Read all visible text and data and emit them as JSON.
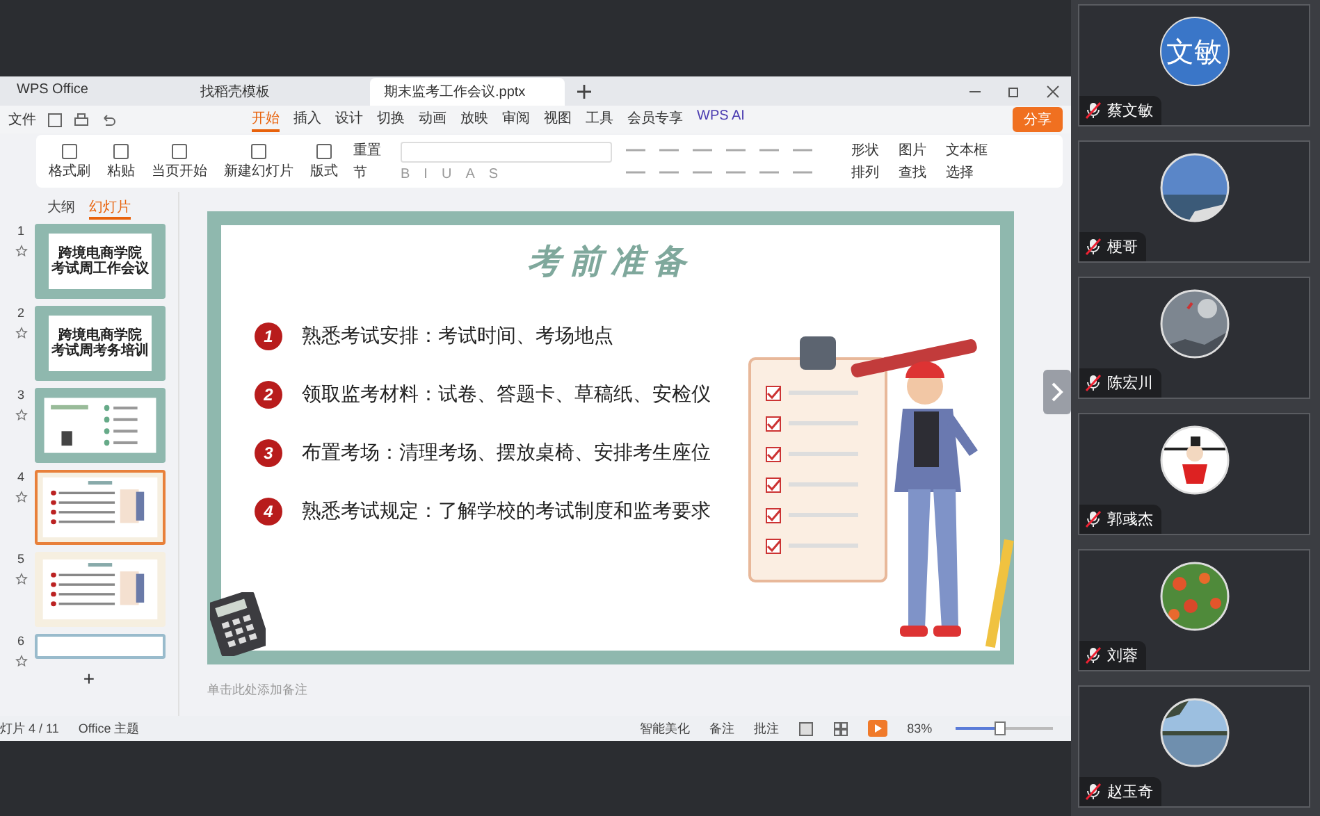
{
  "tabs": [
    {
      "label": "WPS Office",
      "selected": false
    },
    {
      "label": "找稻壳模板",
      "selected": false
    },
    {
      "label": "期末监考工作会议.pptx",
      "selected": true
    }
  ],
  "menu": {
    "file": "文件",
    "tabs": [
      {
        "label": "开始",
        "selected": true
      },
      {
        "label": "插入",
        "selected": false
      },
      {
        "label": "设计",
        "selected": false
      },
      {
        "label": "切换",
        "selected": false
      },
      {
        "label": "动画",
        "selected": false
      },
      {
        "label": "放映",
        "selected": false
      },
      {
        "label": "审阅",
        "selected": false
      },
      {
        "label": "视图",
        "selected": false
      },
      {
        "label": "工具",
        "selected": false
      },
      {
        "label": "会员专享",
        "selected": false
      }
    ],
    "ai": "WPS AI",
    "share": "分享"
  },
  "ribbon": {
    "left": [
      {
        "label": "格式刷"
      },
      {
        "label": "粘贴"
      },
      {
        "label": "当页开始"
      },
      {
        "label": "新建幻灯片"
      },
      {
        "label": "版式"
      }
    ],
    "small": [
      {
        "label": "重置"
      },
      {
        "label": "节"
      }
    ],
    "format_buttons": [
      "B",
      "I",
      "U",
      "A",
      "S"
    ],
    "right": [
      {
        "label": "形状"
      },
      {
        "label": "图片"
      },
      {
        "label": "文本框"
      },
      {
        "label": "排列"
      },
      {
        "label": "查找"
      },
      {
        "label": "选择"
      }
    ]
  },
  "panel": {
    "tabs": [
      {
        "label": "大纲",
        "selected": false
      },
      {
        "label": "幻灯片",
        "selected": true
      }
    ],
    "slides": [
      {
        "number": "1",
        "kind": "title",
        "lines": [
          "跨境电商学院",
          "考试周工作会议"
        ],
        "selected": false
      },
      {
        "number": "2",
        "kind": "title",
        "lines": [
          "跨境电商学院",
          "考试周考务培训"
        ],
        "selected": false
      },
      {
        "number": "3",
        "kind": "list",
        "selected": false
      },
      {
        "number": "4",
        "kind": "content",
        "selected": true
      },
      {
        "number": "5",
        "kind": "content",
        "selected": false
      },
      {
        "number": "6",
        "kind": "partial",
        "selected": false
      }
    ],
    "add": "+"
  },
  "slide": {
    "title": "考前准备",
    "items": [
      {
        "number": "1",
        "text": "熟悉考试安排：考试时间、考场地点"
      },
      {
        "number": "2",
        "text": "领取监考材料：试卷、答题卡、草稿纸、安检仪"
      },
      {
        "number": "3",
        "text": "布置考场：清理考场、摆放桌椅、安排考生座位"
      },
      {
        "number": "4",
        "text": "熟悉考试规定：了解学校的考试制度和监考要求"
      }
    ]
  },
  "notes": {
    "placeholder": "单击此处添加备注"
  },
  "status_bar": {
    "slide_count": "灯片 4 / 11",
    "theme": "Office 主题",
    "beautify": "智能美化",
    "notes": "备注",
    "comments": "批注",
    "zoom": "83%",
    "zoom_slider": {
      "level": 0.45
    }
  },
  "participants": [
    {
      "name": "蔡文敏",
      "muted": true,
      "avatar": {
        "kind": "text",
        "text": "文敏"
      }
    },
    {
      "name": "梗哥",
      "muted": true
    },
    {
      "name": "陈宏川",
      "muted": true
    },
    {
      "name": "郭彧杰",
      "muted": true
    },
    {
      "name": "刘蓉",
      "muted": true
    },
    {
      "name": "赵玉奇",
      "muted": true
    }
  ]
}
